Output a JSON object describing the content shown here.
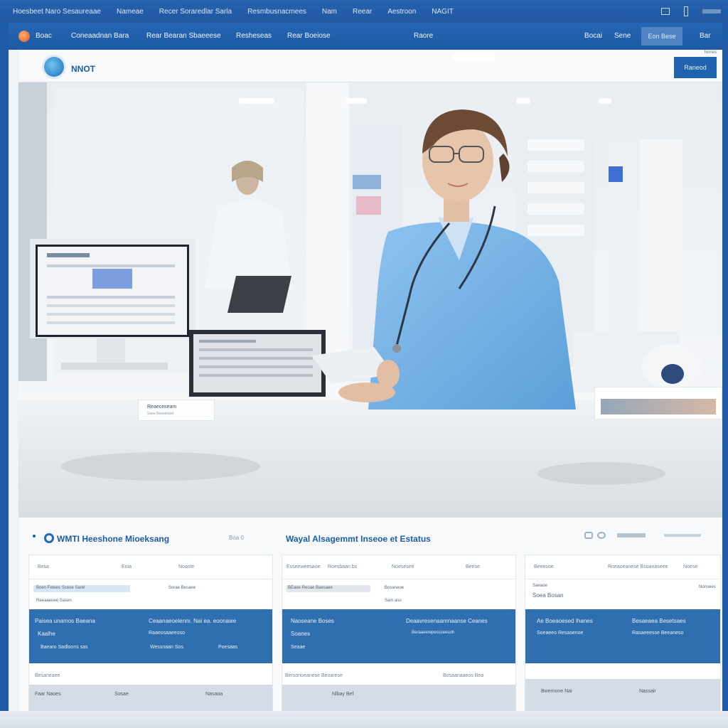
{
  "topbar": {
    "items": [
      "Hoesbeet Naro Sesaureaae",
      "Nameae",
      "Recer Soraredlar Sarla",
      "Resmbusnacmees",
      "Nam",
      "Reear",
      "Aestroon",
      "NAGIT"
    ]
  },
  "navbar": {
    "items": [
      "Boac",
      "Coneaadnan Bara",
      "Rear Bearan Sbaeeese",
      "Resheseas",
      "Rear Boeiose",
      "Raore",
      "Bocai",
      "Sene",
      "Eon Bese",
      "Bar"
    ]
  },
  "window": {
    "brand": "NNOT",
    "header_button": "Raneod",
    "header_tiny": "Nones"
  },
  "hero": {
    "chip_left_label": "Reaeceseam",
    "chip_left_sub": "Saee Besoersad"
  },
  "dashboard": {
    "title_left": "WMTI Heeshone Mioeksang",
    "count": "Boa 0",
    "title_center": "Wayal Alsagemmt Inseoe et Estatus",
    "panels": [
      {
        "tabs": [
          "Besa",
          "Eoia",
          "Noaste"
        ],
        "info": [
          "Boen Fetees Sceoe Sarel",
          "Sorae Besaee",
          "Reeaaeuee Sasen"
        ],
        "blue": [
          "Paisea unamos Baeana",
          "Ceaanaeoelenm. Nai ea. eoonawe",
          "Kaalhe",
          "Raaeosaaeeoso",
          "Baearo Sadloons sas",
          "Wessnaan Sos",
          "Poesaas"
        ],
        "footer_left": "Besaneaee",
        "grey": [
          "Faar Naoes",
          "Sosae",
          "Nasaoa"
        ]
      },
      {
        "tabs": [
          "Esseeweesaoe",
          "Roesbaan bs",
          "Noesesee",
          "Beese"
        ],
        "info": [
          "BEaee Reoae Baesaee",
          "Bosaneoe",
          "Sam aso"
        ],
        "blue": [
          "Naoseane Boses",
          "Deaavresenaamnaanse Ceanes",
          "Soanes",
          "Beraaeerepessseesoh",
          "Seaae"
        ],
        "footer_left": "Bersonoeanese Beoarese",
        "footer_right": "Bosaanaaeos Bea",
        "grey": [
          "Nlbay Bef"
        ]
      },
      {
        "tabs": [
          "Beeesoe",
          "Rneaoeanese Bsoanaseee",
          "Noese"
        ],
        "info": [
          "Saeaoe",
          "Soea Bosan",
          "Nonsees"
        ],
        "blue": [
          "Ae Boeaoesed Ihanes",
          "Besaeaea Besetsaes",
          "Soeaeeo Resasenoe",
          "Rasaeeesse Beeaneso"
        ],
        "grey": [
          "Bwemone Nai",
          "Nassair"
        ]
      }
    ]
  }
}
